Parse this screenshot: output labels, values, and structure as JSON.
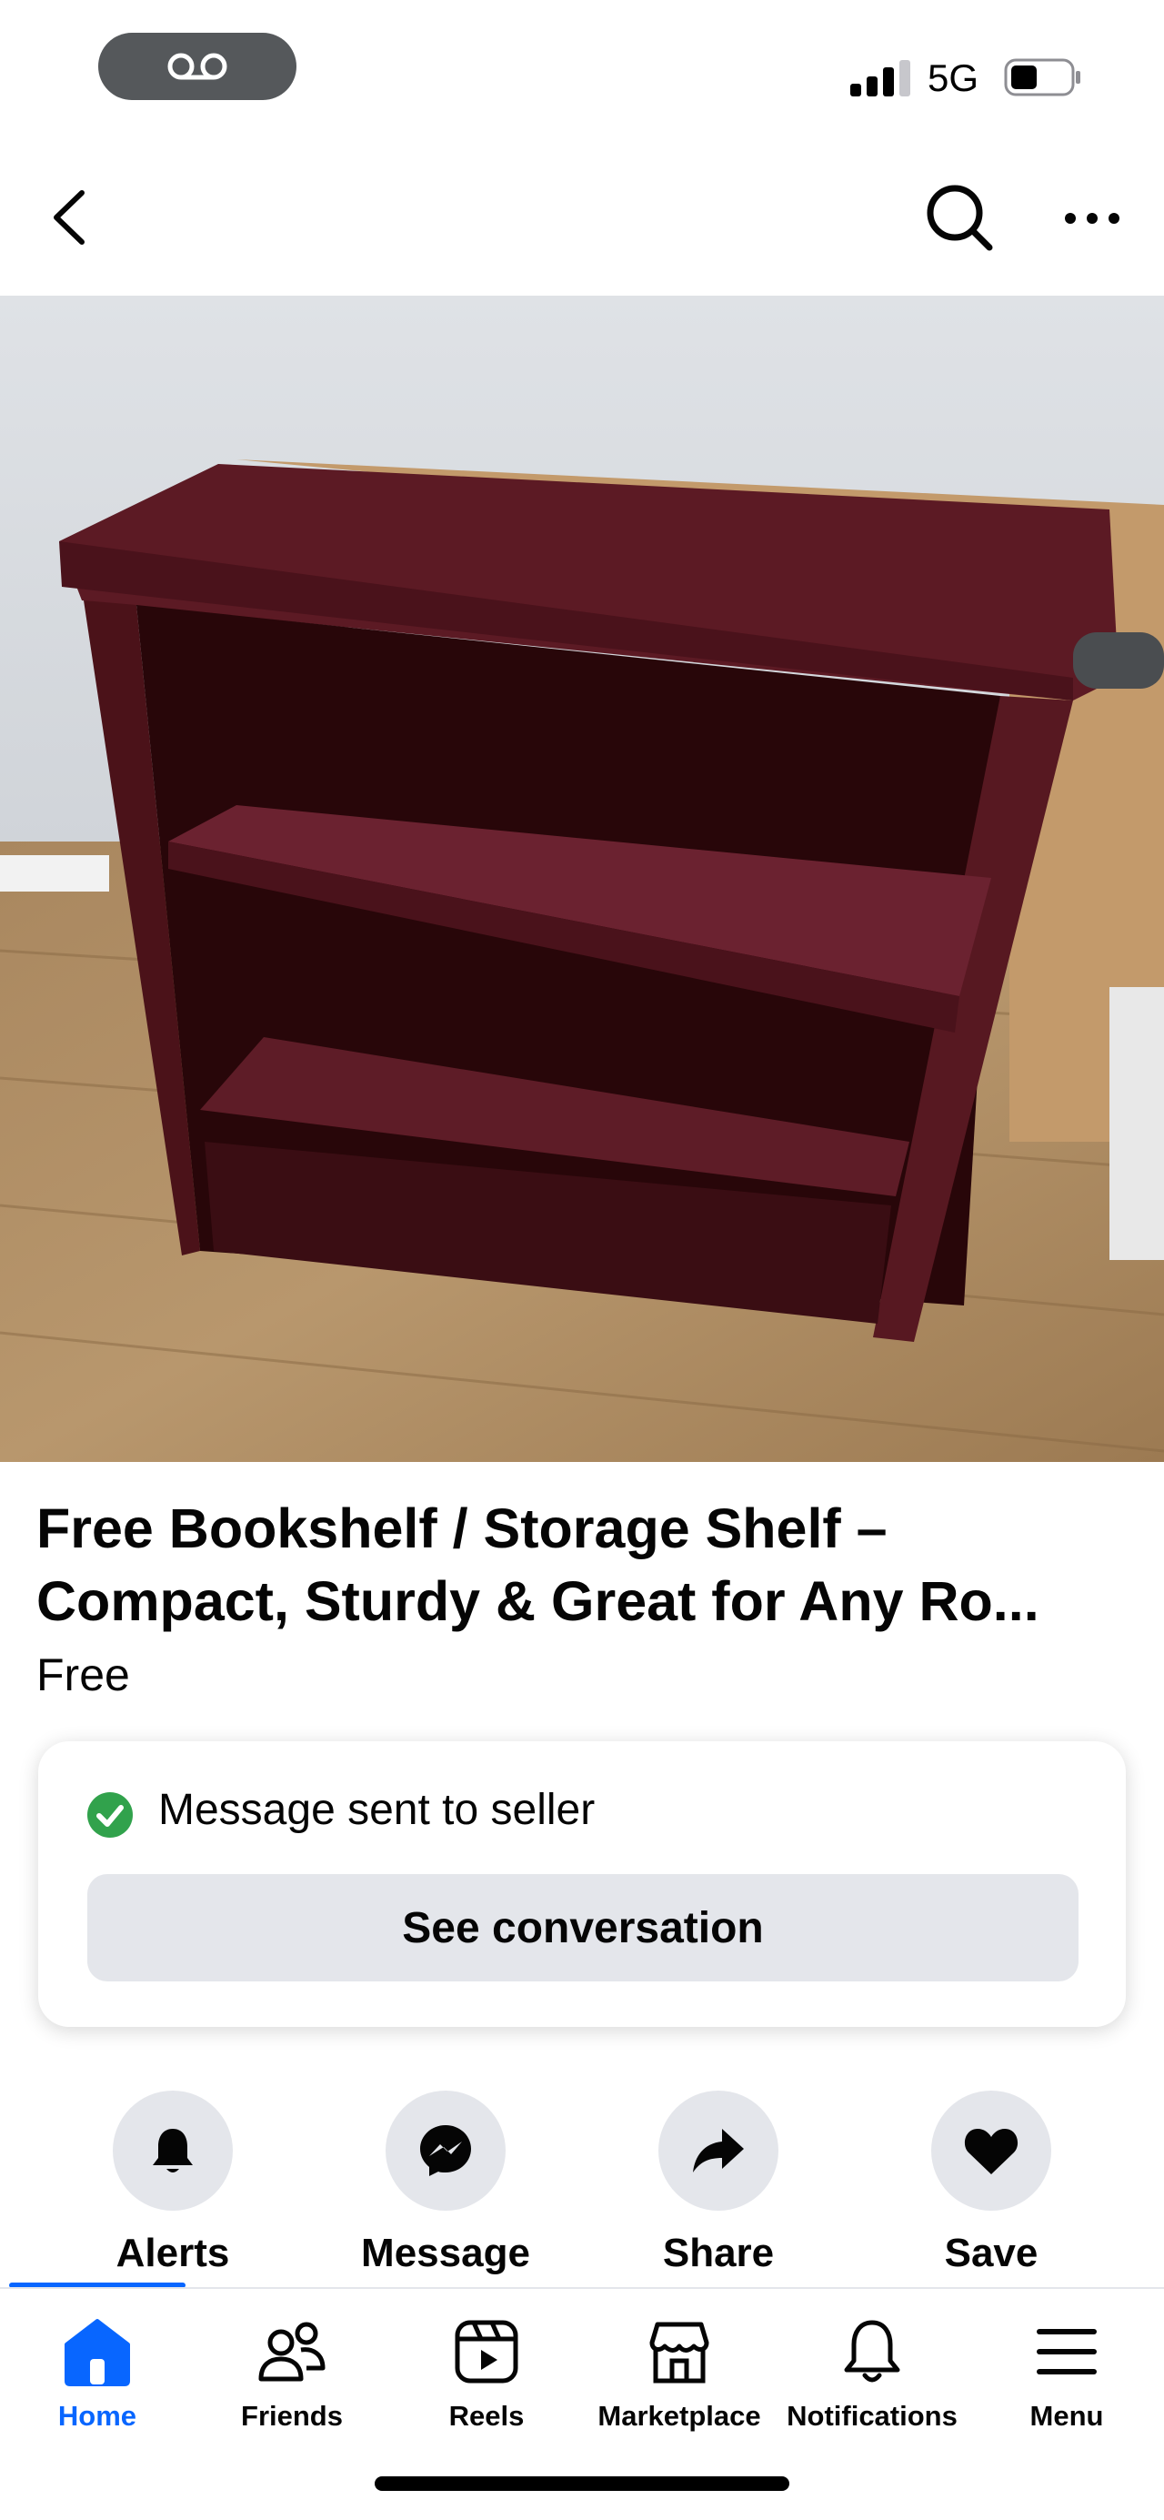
{
  "status_bar": {
    "carrier": "5G",
    "voicemail_icon": "voicemail-icon",
    "signal_icon": "signal-bars-icon",
    "battery_icon": "battery-icon"
  },
  "top_bar": {
    "back_icon": "chevron-left-icon",
    "search_icon": "search-icon",
    "more_icon": "more-dots-icon"
  },
  "listing": {
    "photo": "wooden-bookshelf-photo",
    "title_line1": "Free Bookshelf / Storage Shelf –",
    "title_line2": "Compact, Sturdy & Great for Any Ro...",
    "price": "Free"
  },
  "message_card": {
    "status_text": "Message sent to seller",
    "button_label": "See conversation",
    "status_color": "#31a24c"
  },
  "actions": [
    {
      "label": "Alerts",
      "icon": "bell-icon"
    },
    {
      "label": "Message",
      "icon": "messenger-icon"
    },
    {
      "label": "Share",
      "icon": "share-arrow-icon"
    },
    {
      "label": "Save",
      "icon": "heart-icon"
    }
  ],
  "bottom_nav": {
    "accent": "#0866ff",
    "tabs": [
      {
        "label": "Home",
        "icon": "home-icon",
        "active": true
      },
      {
        "label": "Friends",
        "icon": "friends-icon"
      },
      {
        "label": "Reels",
        "icon": "reels-icon"
      },
      {
        "label": "Marketplace",
        "icon": "marketplace-icon"
      },
      {
        "label": "Notifications",
        "icon": "bell-outline-icon"
      },
      {
        "label": "Menu",
        "icon": "hamburger-menu-icon"
      }
    ]
  }
}
